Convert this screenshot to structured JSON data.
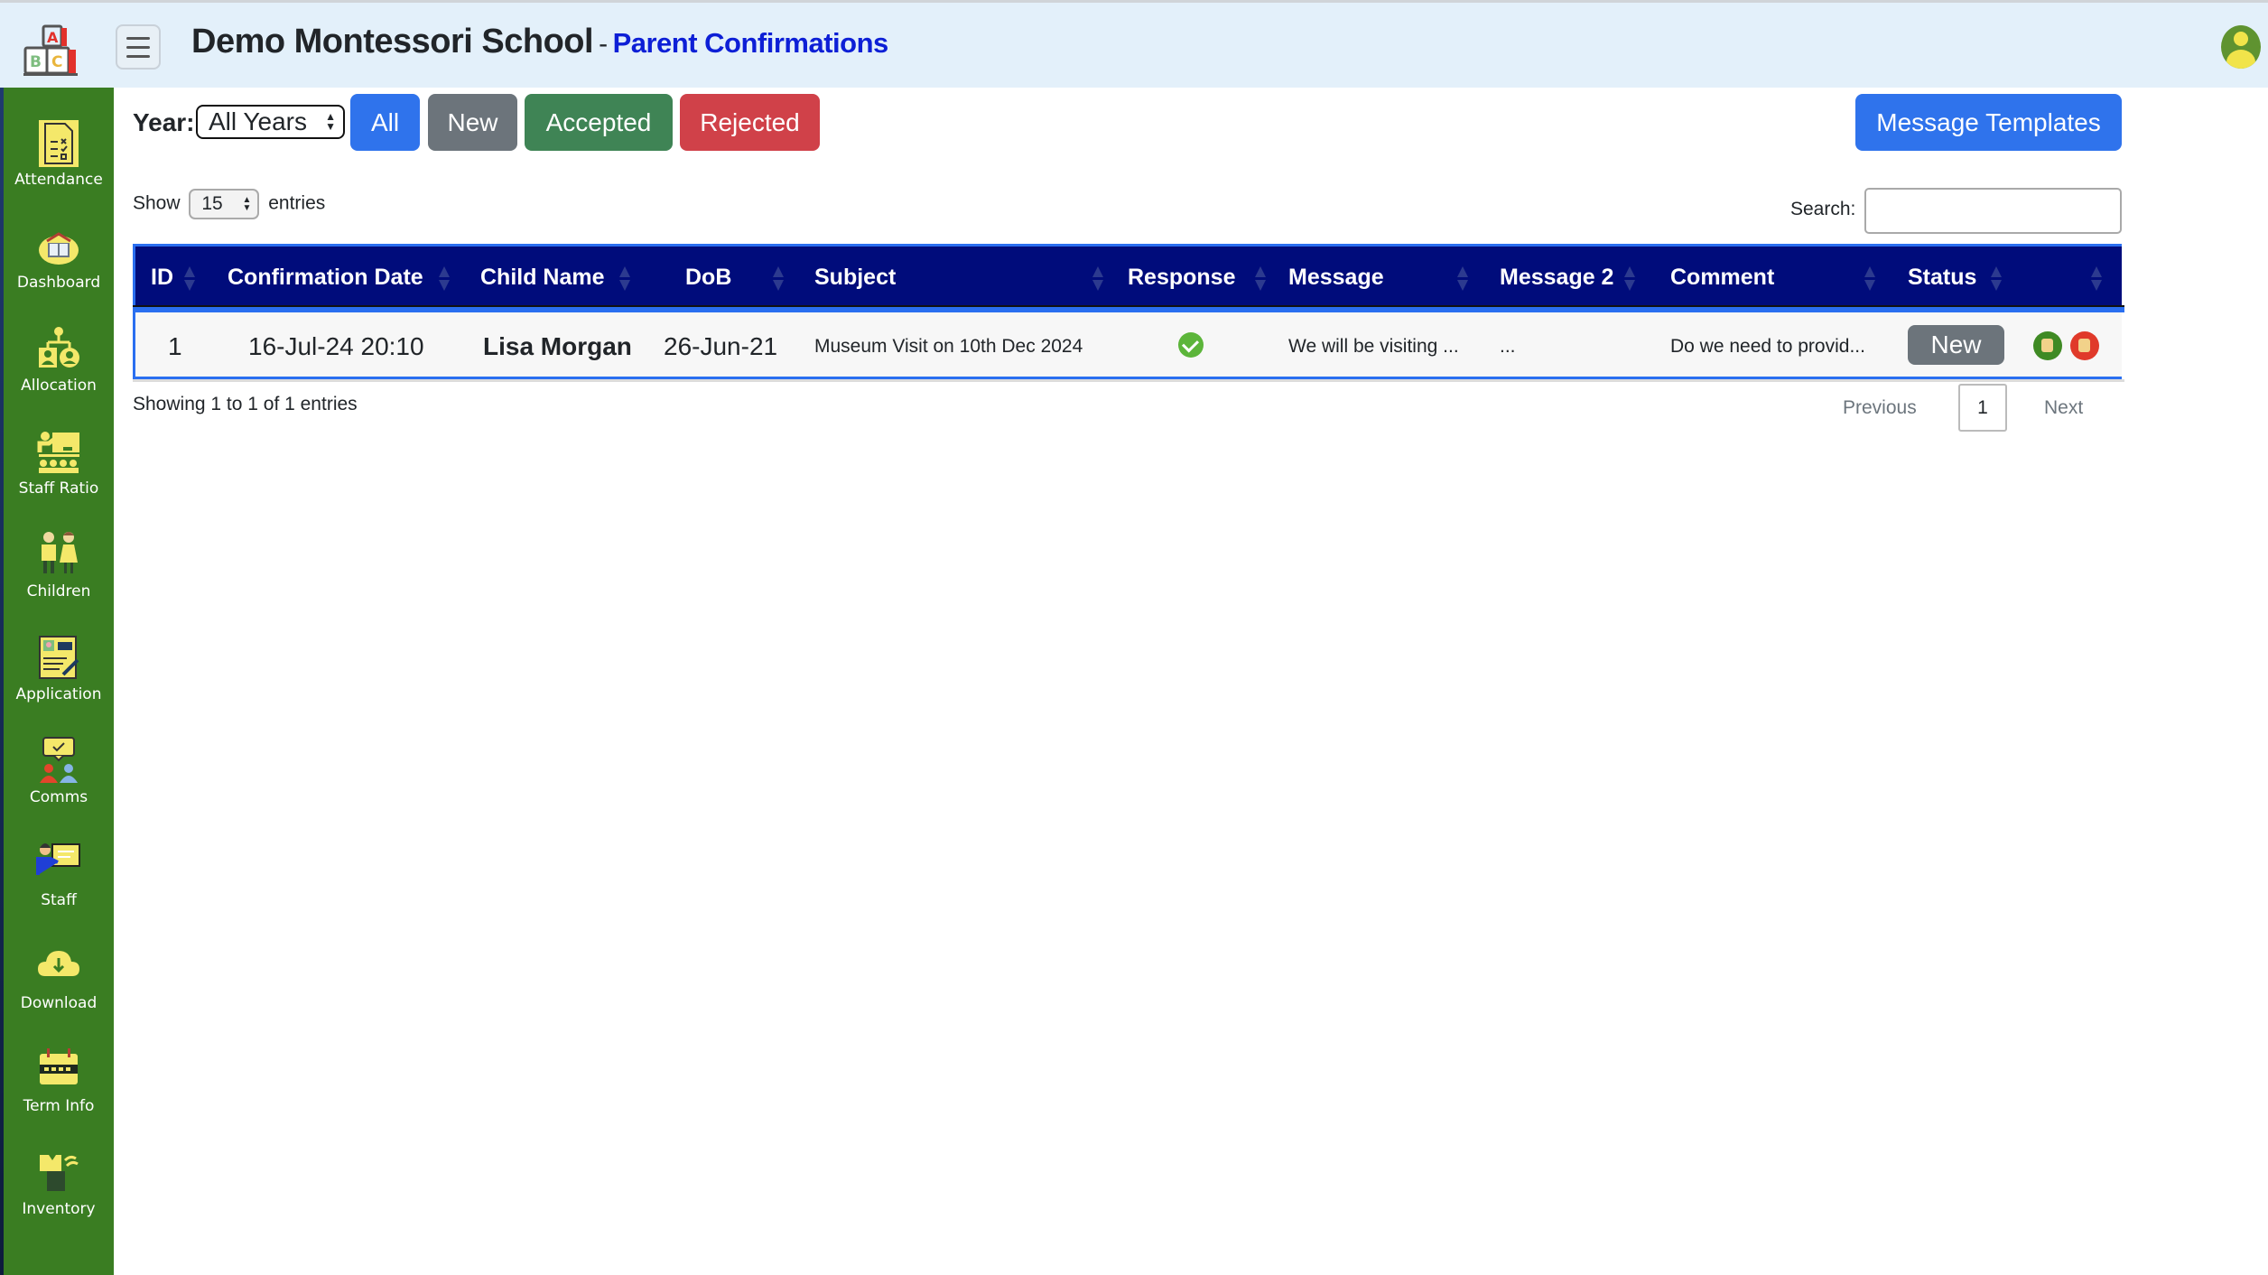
{
  "header": {
    "school_name": "Demo Montessori School",
    "separator": "-",
    "page_title": "Parent Confirmations",
    "logo_icon": "abc-blocks-icon",
    "menu_icon": "hamburger-icon",
    "user_icon": "user-avatar-icon"
  },
  "sidebar": {
    "items": [
      {
        "label": "Attendance",
        "icon": "attendance-checklist-icon"
      },
      {
        "label": "Dashboard",
        "icon": "dashboard-book-icon"
      },
      {
        "label": "Allocation",
        "icon": "allocation-chart-icon"
      },
      {
        "label": "Staff Ratio",
        "icon": "teacher-class-icon"
      },
      {
        "label": "Children",
        "icon": "children-icon"
      },
      {
        "label": "Application",
        "icon": "application-form-icon"
      },
      {
        "label": "Comms",
        "icon": "chat-people-icon"
      },
      {
        "label": "Staff",
        "icon": "staff-presenting-icon"
      },
      {
        "label": "Download",
        "icon": "cloud-download-icon"
      },
      {
        "label": "Term Info",
        "icon": "calendar-icon"
      },
      {
        "label": "Inventory",
        "icon": "uniform-inventory-icon"
      }
    ]
  },
  "filters": {
    "year_label": "Year:",
    "year_value": "All Years",
    "buttons": {
      "all": "All",
      "new": "New",
      "accepted": "Accepted",
      "rejected": "Rejected"
    },
    "message_templates": "Message Templates"
  },
  "colors": {
    "sidebar_bg": "#3a7d22",
    "header_bg": "#e3f0fa",
    "table_header_bg": "#000c7b",
    "primary": "#2f73ec",
    "secondary": "#6c747b",
    "success": "#3f8455",
    "danger": "#d04149",
    "title_accent": "#0d1fd6"
  },
  "table_controls": {
    "show_label": "Show",
    "entries_value": "15",
    "entries_label": "entries",
    "search_label": "Search:",
    "search_value": ""
  },
  "table": {
    "columns": [
      "ID",
      "Confirmation Date",
      "Child Name",
      "DoB",
      "Subject",
      "Response",
      "Message",
      "Message 2",
      "Comment",
      "Status",
      ""
    ],
    "rows": [
      {
        "id": "1",
        "confirmation_date": "16-Jul-24 20:10",
        "child_name": "Lisa Morgan",
        "dob": "26-Jun-21",
        "subject": "Museum Visit on 10th Dec 2024",
        "response": "accepted",
        "response_icon": "green-check-icon",
        "message": "We will be visiting ...",
        "message2": "...",
        "comment": "Do we need to provid...",
        "status": "New",
        "actions": [
          "thumbs-up-icon",
          "thumbs-down-icon"
        ]
      }
    ]
  },
  "footer": {
    "info": "Showing 1 to 1 of 1 entries",
    "previous": "Previous",
    "current_page": "1",
    "next": "Next"
  }
}
